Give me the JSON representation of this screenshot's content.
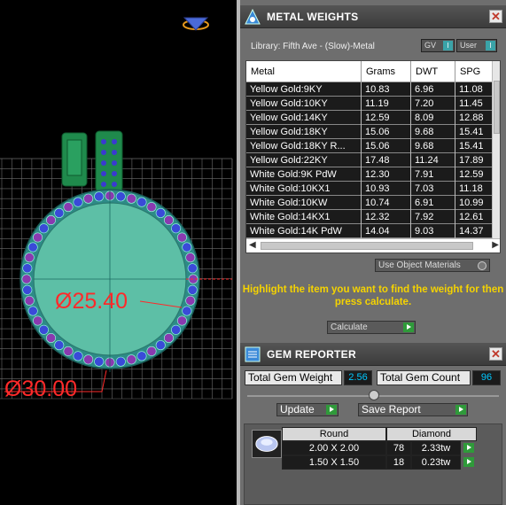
{
  "viewport": {
    "dimension_inner": "Ø25.40",
    "dimension_outer": "Ø30.00"
  },
  "metal_weights": {
    "title": "METAL WEIGHTS",
    "close": "✕",
    "library": "Library: Fifth Ave - (Slow)-Metal",
    "toggle_gv": "GV",
    "toggle_user": "User",
    "toggle_glyph": "I",
    "columns": [
      "Metal",
      "Grams",
      "DWT",
      "SPG"
    ],
    "rows": [
      [
        "Yellow Gold:9KY",
        "10.83",
        "6.96",
        "11.08"
      ],
      [
        "Yellow Gold:10KY",
        "11.19",
        "7.20",
        "11.45"
      ],
      [
        "Yellow Gold:14KY",
        "12.59",
        "8.09",
        "12.88"
      ],
      [
        "Yellow Gold:18KY",
        "15.06",
        "9.68",
        "15.41"
      ],
      [
        "Yellow Gold:18KY R...",
        "15.06",
        "9.68",
        "15.41"
      ],
      [
        "Yellow Gold:22KY",
        "17.48",
        "11.24",
        "17.89"
      ],
      [
        "White Gold:9K PdW",
        "12.30",
        "7.91",
        "12.59"
      ],
      [
        "White Gold:10KX1",
        "10.93",
        "7.03",
        "11.18"
      ],
      [
        "White Gold:10KW",
        "10.74",
        "6.91",
        "10.99"
      ],
      [
        "White Gold:14KX1",
        "12.32",
        "7.92",
        "12.61"
      ],
      [
        "White Gold:14K PdW",
        "14.04",
        "9.03",
        "14.37"
      ]
    ],
    "use_object_materials": "Use Object Materials",
    "hint": "Highlight the item you want to find the weight for then press calculate.",
    "calculate": "Calculate"
  },
  "gem_reporter": {
    "title": "GEM REPORTER",
    "close": "✕",
    "total_weight_label": "Total Gem Weight",
    "total_weight_value": "2.56",
    "total_count_label": "Total Gem Count",
    "total_count_value": "96",
    "update": "Update",
    "save_report": "Save Report",
    "shape_header": "Round",
    "type_header": "Diamond",
    "gems": [
      {
        "size": "2.00 X 2.00",
        "count": "78",
        "weight": "2.33tw"
      },
      {
        "size": "1.50 X 1.50",
        "count": "18",
        "weight": "0.23tw"
      }
    ]
  }
}
